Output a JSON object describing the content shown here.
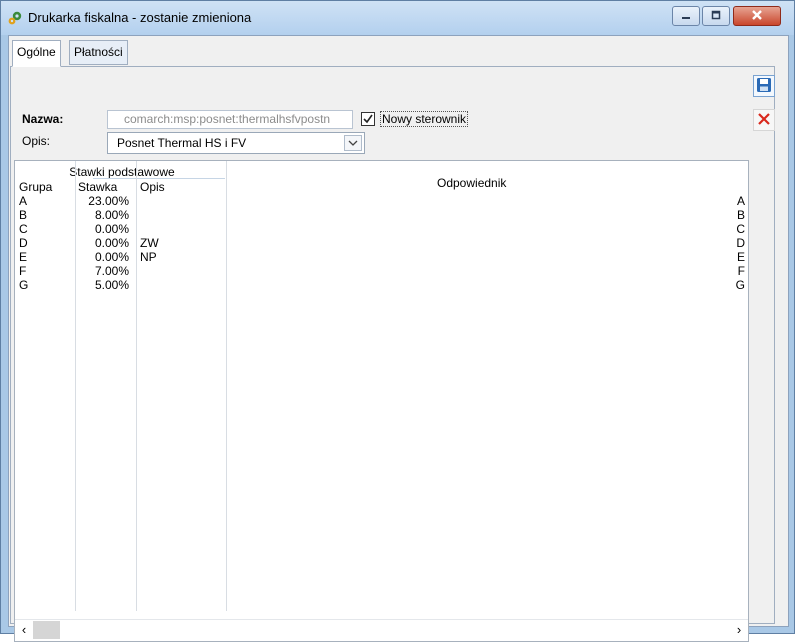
{
  "window": {
    "title": "Drukarka fiskalna - zostanie zmieniona"
  },
  "tabs": [
    {
      "label": "Ogólne"
    },
    {
      "label": "Płatności"
    }
  ],
  "form": {
    "nazwa_label": "Nazwa:",
    "nazwa_value": "comarch:msp:posnet:thermalhsfvpostn",
    "nowy_sterownik_label": "Nowy sterownik",
    "nowy_sterownik_checked": true,
    "opis_label": "Opis:",
    "opis_value": "Posnet Thermal HS i FV"
  },
  "grid": {
    "group_header": "Stawki podstawowe",
    "columns": {
      "grupa": "Grupa",
      "stawka": "Stawka",
      "opis": "Opis"
    },
    "odpowiednik_header": "Odpowiednik",
    "rows": [
      {
        "grupa": "A",
        "stawka": "23.00%",
        "opis": "",
        "odpowiednik": "A"
      },
      {
        "grupa": "B",
        "stawka": "8.00%",
        "opis": "",
        "odpowiednik": "B"
      },
      {
        "grupa": "C",
        "stawka": "0.00%",
        "opis": "",
        "odpowiednik": "C"
      },
      {
        "grupa": "D",
        "stawka": "0.00%",
        "opis": "ZW",
        "odpowiednik": "D"
      },
      {
        "grupa": "E",
        "stawka": "0.00%",
        "opis": "NP",
        "odpowiednik": "E"
      },
      {
        "grupa": "F",
        "stawka": "7.00%",
        "opis": "",
        "odpowiednik": "F"
      },
      {
        "grupa": "G",
        "stawka": "5.00%",
        "opis": "",
        "odpowiednik": "G"
      }
    ]
  },
  "icons": {
    "app": "gear-icon",
    "save": "floppy-disk-icon",
    "cancel": "close-x-icon",
    "minimize": "minimize-icon",
    "maximize": "maximize-icon",
    "close": "window-close-icon"
  },
  "colors": {
    "accent": "#2a6ab6",
    "cancel": "#d9281c",
    "close_button": "#c9462c"
  }
}
